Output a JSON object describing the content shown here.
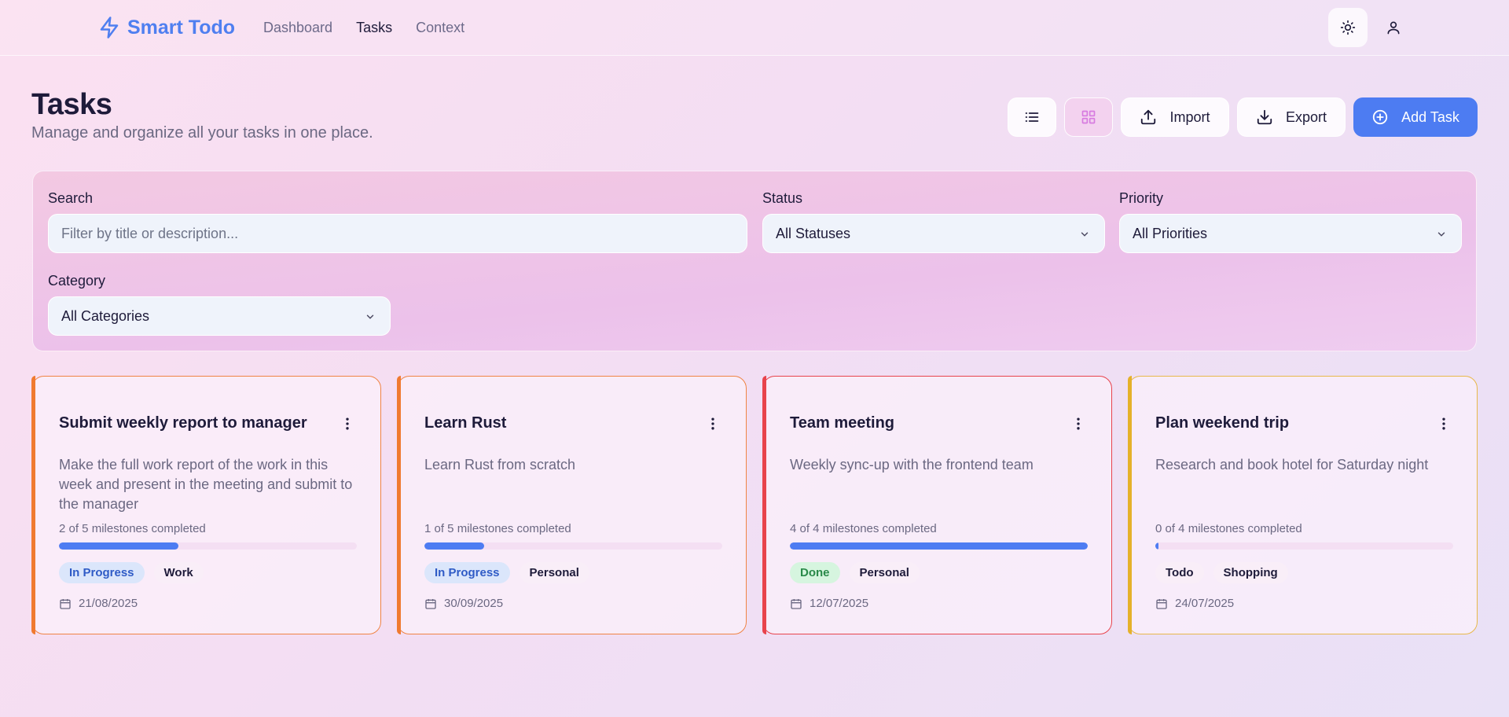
{
  "app": {
    "name": "Smart Todo"
  },
  "nav": {
    "items": [
      {
        "label": "Dashboard",
        "active": false
      },
      {
        "label": "Tasks",
        "active": true
      },
      {
        "label": "Context",
        "active": false
      }
    ]
  },
  "header": {
    "title": "Tasks",
    "subtitle": "Manage and organize all your tasks in one place."
  },
  "toolbar": {
    "import_label": "Import",
    "export_label": "Export",
    "add_label": "Add Task"
  },
  "filters": {
    "search": {
      "label": "Search",
      "placeholder": "Filter by title or description..."
    },
    "status": {
      "label": "Status",
      "value": "All Statuses"
    },
    "priority": {
      "label": "Priority",
      "value": "All Priorities"
    },
    "category": {
      "label": "Category",
      "value": "All Categories"
    }
  },
  "tasks": [
    {
      "title": "Submit weekly report to manager",
      "description": "Make the full work report of the work in this week and present in the meeting and submit to the manager",
      "milestones": "2 of 5 milestones completed",
      "progress": 0.4,
      "status": "In Progress",
      "category": "Work",
      "date": "21/08/2025",
      "accent": "#f07a30",
      "border": "#f08444"
    },
    {
      "title": "Learn Rust",
      "description": "Learn Rust from scratch",
      "milestones": "1 of 5 milestones completed",
      "progress": 0.2,
      "status": "In Progress",
      "category": "Personal",
      "date": "30/09/2025",
      "accent": "#f07a30",
      "border": "#f08444"
    },
    {
      "title": "Team meeting",
      "description": "Weekly sync-up with the frontend team",
      "milestones": "4 of 4 milestones completed",
      "progress": 1.0,
      "status": "Done",
      "category": "Personal",
      "date": "12/07/2025",
      "accent": "#e8434c",
      "border": "#e8434c"
    },
    {
      "title": "Plan weekend trip",
      "description": "Research and book hotel for Saturday night",
      "milestones": "0 of 4 milestones completed",
      "progress": 0.0,
      "status": "Todo",
      "category": "Shopping",
      "date": "24/07/2025",
      "accent": "#e5b12a",
      "border": "#e8b84a"
    }
  ]
}
